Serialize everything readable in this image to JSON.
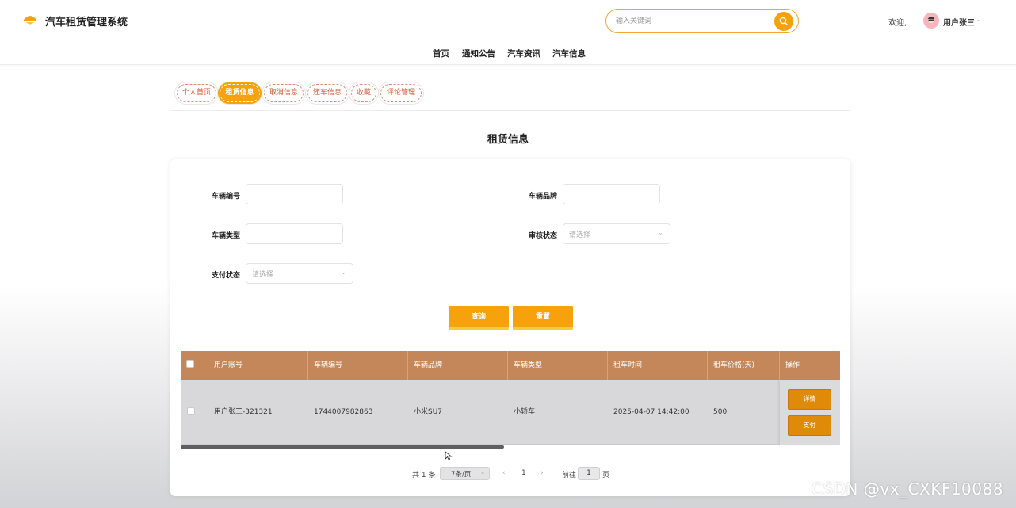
{
  "header": {
    "title": "汽车租赁管理系统",
    "search_placeholder": "输入关键词",
    "welcome": "欢迎,",
    "user_name": "用户张三",
    "brand_color": "#f5a20c"
  },
  "nav": [
    "首页",
    "通知公告",
    "汽车资讯",
    "汽车信息"
  ],
  "tabs": [
    {
      "label": "个人首页",
      "active": false
    },
    {
      "label": "租赁信息",
      "active": true
    },
    {
      "label": "取消信息",
      "active": false
    },
    {
      "label": "还车信息",
      "active": false
    },
    {
      "label": "收藏",
      "active": false
    },
    {
      "label": "评论管理",
      "active": false
    }
  ],
  "page_title": "租赁信息",
  "filters": {
    "vehicle_no_label": "车辆编号",
    "brand_label": "车辆品牌",
    "type_label": "车辆类型",
    "review_label": "审核状态",
    "review_placeholder": "请选择",
    "pay_label": "支付状态",
    "pay_placeholder": "请选择",
    "query_button": "查询",
    "reset_button": "重置"
  },
  "table": {
    "headers": [
      "用户账号",
      "车辆编号",
      "车辆品牌",
      "车辆类型",
      "租车时间",
      "租车价格(天)",
      "操作"
    ],
    "rows": [
      {
        "account": "用户张三-321321",
        "vehicle_no": "1744007982863",
        "brand": "小米SU7",
        "type": "小轿车",
        "rent_time": "2025-04-07 14:42:00",
        "price": "500",
        "detail_button": "详情",
        "pay_button": "支付"
      }
    ],
    "header_color": "#c4875a"
  },
  "pagination": {
    "total": "共 1 条",
    "page_size": "7条/页",
    "current_page": "1",
    "goto_label": "前往",
    "goto_value": "1",
    "page_suffix": "页"
  },
  "watermark": "CSDN @vx_CXKF10088"
}
